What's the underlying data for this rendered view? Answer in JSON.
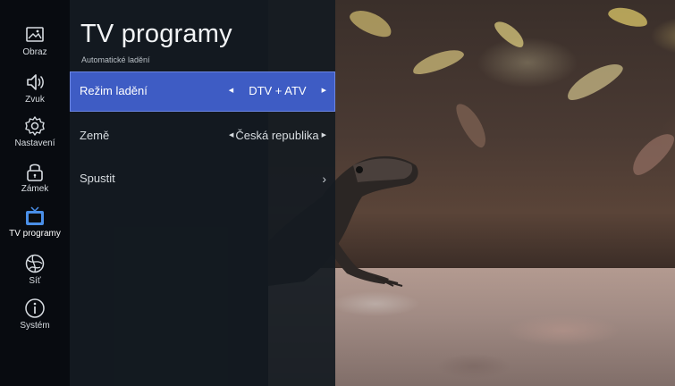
{
  "sidebar": {
    "items": [
      {
        "label": "Obraz",
        "icon": "picture-icon"
      },
      {
        "label": "Zvuk",
        "icon": "speaker-icon"
      },
      {
        "label": "Nastavení",
        "icon": "gear-icon"
      },
      {
        "label": "Zámek",
        "icon": "lock-icon"
      },
      {
        "label": "TV programy",
        "icon": "tv-icon",
        "selected": true
      },
      {
        "label": "Síť",
        "icon": "globe-icon"
      },
      {
        "label": "Systém",
        "icon": "info-icon"
      }
    ]
  },
  "panel": {
    "title": "TV programy",
    "subtitle": "Automatické ladění",
    "rows": [
      {
        "label": "Režim ladění",
        "value": "DTV + ATV",
        "selected": true,
        "left_arrow": "◀",
        "right_arrow": "▶"
      },
      {
        "label": "Země",
        "value": "Česká republika",
        "left_arrow": "◀",
        "right_arrow": "▶"
      },
      {
        "label": "Spustit",
        "chevron": "›"
      }
    ]
  },
  "colors": {
    "accent": "#3e5cc4",
    "tv_icon": "#4a8fe8"
  }
}
